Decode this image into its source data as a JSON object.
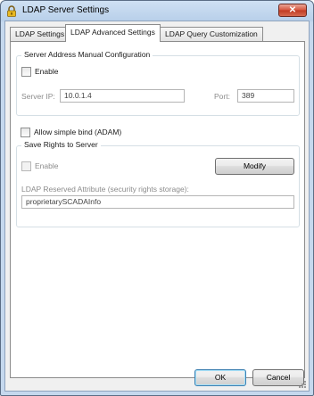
{
  "window": {
    "title": "LDAP Server Settings",
    "close_glyph": "✕"
  },
  "tabs": [
    {
      "label": "LDAP Settings",
      "active": false
    },
    {
      "label": "LDAP Advanced Settings",
      "active": true
    },
    {
      "label": "LDAP Query Customization",
      "active": false
    }
  ],
  "server_address": {
    "title": "Server Address Manual Configuration",
    "enable_label": "Enable",
    "enable_checked": false,
    "server_ip_label": "Server IP:",
    "server_ip_value": "10.0.1.4",
    "port_label": "Port:",
    "port_value": "389"
  },
  "simple_bind": {
    "label": "Allow simple bind (ADAM)",
    "checked": false
  },
  "save_rights": {
    "title": "Save Rights to Server",
    "enable_label": "Enable",
    "enable_checked": false,
    "modify_label": "Modify",
    "attribute_label": "LDAP Reserved Attribute (security rights storage):",
    "attribute_value": "proprietarySCADAInfo"
  },
  "footer": {
    "ok_label": "OK",
    "cancel_label": "Cancel"
  },
  "icons": {
    "app": "padlock-icon",
    "close": "close-icon",
    "grip": "resize-grip-icon"
  },
  "colors": {
    "titlebar": "#c5d8ee",
    "close_button": "#d5533c",
    "default_button_border": "#3c7fb1"
  }
}
